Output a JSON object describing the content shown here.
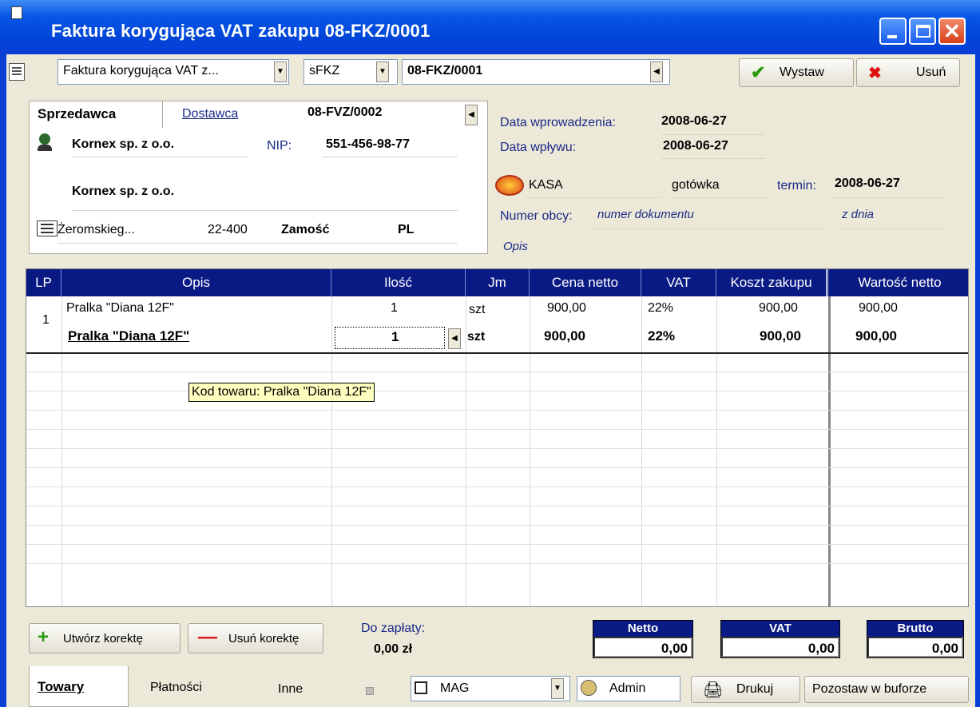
{
  "window": {
    "title": "Faktura korygująca VAT zakupu 08-FKZ/0001"
  },
  "toolbar": {
    "doc_type": "Faktura korygująca VAT z...",
    "series": "sFKZ",
    "number": "08-FKZ/0001",
    "issue_label": "Wystaw",
    "delete_label": "Usuń"
  },
  "seller": {
    "tab_seller": "Sprzedawca",
    "tab_supplier": "Dostawca",
    "ref_doc": "08-FVZ/0002",
    "name_short": "Kornex sp. z o.o.",
    "nip_label": "NIP:",
    "nip": "551-456-98-77",
    "name_full": "Kornex sp. z o.o.",
    "street": "Żeromskieg...",
    "postcode": "22-400",
    "city": "Zamość",
    "country": "PL"
  },
  "dates": {
    "entry_label": "Data wprowadzenia:",
    "entry": "2008-06-27",
    "receipt_label": "Data wpływu:",
    "receipt": "2008-06-27",
    "cashbox": "KASA",
    "payment": "gotówka",
    "due_label": "termin:",
    "due": "2008-06-27",
    "foreign_no_label": "Numer obcy:",
    "foreign_no_placeholder": "numer dokumentu",
    "from_date_placeholder": "z dnia",
    "description_placeholder": "Opis"
  },
  "grid": {
    "columns": [
      "LP",
      "Opis",
      "Ilość",
      "Jm",
      "Cena netto",
      "VAT",
      "Koszt zakupu",
      "Wartość netto"
    ],
    "row_lp": "1",
    "orig": {
      "desc": "Pralka \"Diana 12F\"",
      "qty": "1",
      "unit": "szt",
      "price": "900,00",
      "vat": "22%",
      "cost": "900,00",
      "net": "900,00"
    },
    "corr": {
      "desc": "Pralka \"Diana 12F\"",
      "qty": "1",
      "unit": "szt",
      "price": "900,00",
      "vat": "22%",
      "cost": "900,00",
      "net": "900,00"
    },
    "tooltip": "Kod towaru: Pralka \"Diana 12F\""
  },
  "footer": {
    "create_corr": "Utwórz korektę",
    "delete_corr": "Usuń korektę",
    "to_pay_label": "Do zapłaty:",
    "to_pay": "0,00  zł",
    "netto_label": "Netto",
    "netto": "0,00",
    "vat_label": "VAT",
    "vat": "0,00",
    "brutto_label": "Brutto",
    "brutto": "0,00"
  },
  "tabs": {
    "items": "Towary",
    "payments": "Płatności",
    "other": "Inne"
  },
  "status": {
    "warehouse": "MAG",
    "user": "Admin",
    "print_label": "Drukuj",
    "leave_buffer": "Pozostaw w buforze"
  },
  "colors": {
    "title_bar": "#0a3fd6",
    "grid_header": "#0a1a84",
    "tooltip": "#ffffc0",
    "face": "#ece9d8"
  }
}
